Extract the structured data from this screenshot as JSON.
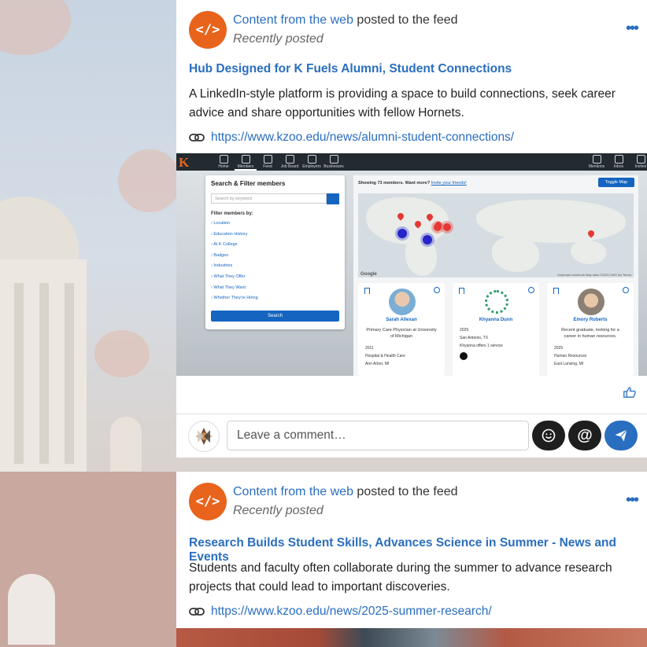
{
  "posts": [
    {
      "source": "Content from the web",
      "action": "posted to the feed",
      "time": "Recently posted",
      "title": "Hub Designed for K Fuels Alumni, Student Connections",
      "body": "A LinkedIn-style platform is providing a space to build connections, seek career advice and share opportunities with fellow Hornets.",
      "url": "https://www.kzoo.edu/news/alumni-student-connections/",
      "preview": {
        "logo": "K",
        "nav": [
          "Home",
          "Members",
          "Feed",
          "Job Board",
          "Employers",
          "Businesses"
        ],
        "nav_right": [
          "Mentions",
          "Inbox",
          "Invites"
        ],
        "search_title": "Search & Filter members",
        "search_placeholder": "Search by keyword",
        "filter_label": "Filter members by:",
        "filters": [
          "Location",
          "Education History",
          "At K College",
          "Badges",
          "Industries",
          "What They Offer",
          "What They Want",
          "Whether They're Hiring"
        ],
        "search_button": "Search",
        "showing": "Showing 73 members. Want more?",
        "invite": "Invite your friends!",
        "toggle": "Toggle Map",
        "map_brand": "Google",
        "map_credit": "Keyboard shortcuts  Map data ©2025  1000 km  Terms",
        "members": [
          {
            "name": "Sarah Allexan",
            "desc": "Primary Care Physician at University of Michigan",
            "lines": [
              "2011",
              "Hospital & Health Care",
              "Ann Arbor, MI"
            ]
          },
          {
            "name": "Khyanna Dunn",
            "desc": "",
            "lines": [
              "2029",
              "San Antonio, TX",
              "Khyanna offers 1 service"
            ]
          },
          {
            "name": "Emory Roberts",
            "desc": "Recent graduate, looking for a career in human resources.",
            "lines": [
              "2025",
              "Human Resources",
              "East Lansing, MI"
            ]
          }
        ]
      }
    },
    {
      "source": "Content from the web",
      "action": "posted to the feed",
      "time": "Recently posted",
      "title": "Research Builds Student Skills, Advances Science in Summer - News and Events",
      "body": "Students and faculty often collaborate during the summer to advance research projects that could lead to important discoveries.",
      "url": "https://www.kzoo.edu/news/2025-summer-research/"
    }
  ],
  "comment": {
    "placeholder": "Leave a comment…"
  },
  "icons": {
    "source": "code-icon",
    "more": "more-dots-icon",
    "link": "link-icon",
    "like": "thumbs-up-icon",
    "emoji": "emoji-icon",
    "mention": "at-icon",
    "send": "send-icon"
  },
  "colors": {
    "accent": "#2a6ebf",
    "source_avatar": "#e8641c",
    "dark_button": "#1e1e1e"
  }
}
